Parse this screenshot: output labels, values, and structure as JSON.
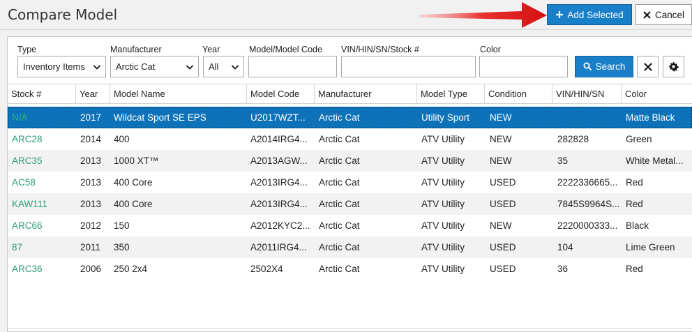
{
  "window": {
    "title": "Compare Model"
  },
  "toolbar": {
    "add_label": "Add Selected",
    "cancel_label": "Cancel"
  },
  "filters": {
    "type": {
      "label": "Type",
      "value": "Inventory Items"
    },
    "manufacturer": {
      "label": "Manufacturer",
      "value": "Arctic Cat"
    },
    "year": {
      "label": "Year",
      "value": "All"
    },
    "model": {
      "label": "Model/Model Code",
      "value": ""
    },
    "vin": {
      "label": "VIN/HIN/SN/Stock #",
      "value": ""
    },
    "color": {
      "label": "Color",
      "value": ""
    },
    "search_label": "Search"
  },
  "table": {
    "columns": [
      "Stock #",
      "Year",
      "Model Name",
      "Model Code",
      "Manufacturer",
      "Model Type",
      "Condition",
      "VIN/HIN/SN",
      "Color"
    ],
    "rows": [
      {
        "stock": "N/A",
        "year": "2017",
        "model_name": "Wildcat Sport SE EPS",
        "model_code": "U2017WZT...",
        "manufacturer": "Arctic Cat",
        "model_type": "Utility Sport",
        "condition": "NEW",
        "vin": "",
        "color": "Matte Black",
        "selected": true
      },
      {
        "stock": "ARC28",
        "year": "2014",
        "model_name": "400",
        "model_code": "A2014IRG4...",
        "manufacturer": "Arctic Cat",
        "model_type": "ATV Utility",
        "condition": "NEW",
        "vin": "282828",
        "color": "Green"
      },
      {
        "stock": "ARC35",
        "year": "2013",
        "model_name": "1000 XT™",
        "model_code": "A2013AGW...",
        "manufacturer": "Arctic Cat",
        "model_type": "ATV Utility",
        "condition": "NEW",
        "vin": "35",
        "color": "White Metal..."
      },
      {
        "stock": "AC58",
        "year": "2013",
        "model_name": "400 Core",
        "model_code": "A2013IRG4...",
        "manufacturer": "Arctic Cat",
        "model_type": "ATV Utility",
        "condition": "USED",
        "vin": "2222336665...",
        "color": "Red"
      },
      {
        "stock": "KAW111",
        "year": "2013",
        "model_name": "400 Core",
        "model_code": "A2013IRG4...",
        "manufacturer": "Arctic Cat",
        "model_type": "ATV Utility",
        "condition": "USED",
        "vin": "7845S9964S...",
        "color": "Red"
      },
      {
        "stock": "ARC66",
        "year": "2012",
        "model_name": "150",
        "model_code": "A2012KYC2...",
        "manufacturer": "Arctic Cat",
        "model_type": "ATV Utility",
        "condition": "NEW",
        "vin": "2220000333...",
        "color": "Black"
      },
      {
        "stock": "87",
        "year": "2011",
        "model_name": "350",
        "model_code": "A2011IRG4...",
        "manufacturer": "Arctic Cat",
        "model_type": "ATV Utility",
        "condition": "USED",
        "vin": "104",
        "color": "Lime Green"
      },
      {
        "stock": "ARC36",
        "year": "2006",
        "model_name": "250 2x4",
        "model_code": "2502X4",
        "manufacturer": "Arctic Cat",
        "model_type": "ATV Utility",
        "condition": "USED",
        "vin": "36",
        "color": "Red"
      }
    ]
  },
  "colors": {
    "accent": "#1a7fc9",
    "selected_row": "#0e72b8",
    "stock_link": "#2a9d73",
    "arrow": "#e01e1e"
  },
  "icons": {
    "add": "plus-icon",
    "cancel": "close-icon",
    "search": "search-icon",
    "clear": "close-icon",
    "settings": "gear-icon"
  }
}
